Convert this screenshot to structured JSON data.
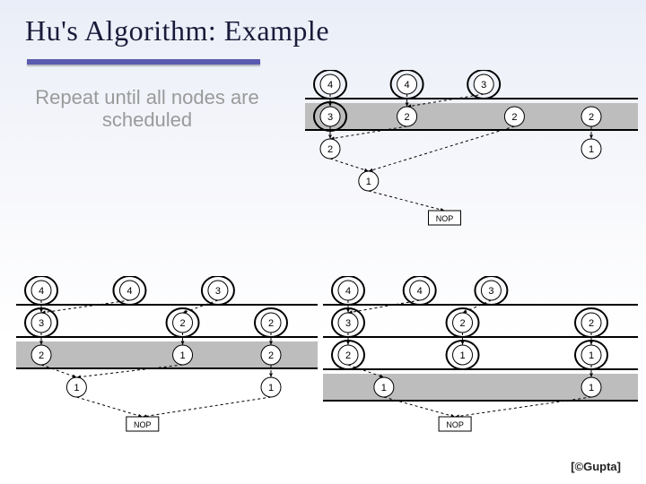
{
  "title": "Hu's Algorithm: Example",
  "subtext": "Repeat until all nodes are scheduled",
  "credit": "[©Gupta]",
  "sink_label": "NOP",
  "chart_data": [
    {
      "type": "dag-panel",
      "name": "top-right",
      "highlight_row": 1,
      "rows": [
        {
          "y": 0,
          "circled": [
            0,
            1,
            2
          ],
          "nodes": [
            {
              "x": 0,
              "label": "4"
            },
            {
              "x": 1,
              "label": "4"
            },
            {
              "x": 2,
              "label": "3"
            }
          ]
        },
        {
          "y": 1,
          "circled": [
            0
          ],
          "nodes": [
            {
              "x": 0,
              "label": "3"
            },
            {
              "x": 1,
              "label": "2"
            },
            {
              "x": 2.4,
              "label": "2"
            },
            {
              "x": 3.4,
              "label": "2"
            }
          ]
        },
        {
          "y": 2,
          "nodes": [
            {
              "x": 0,
              "label": "2"
            },
            {
              "x": 3.4,
              "label": "1"
            }
          ]
        },
        {
          "y": 3,
          "nodes": [
            {
              "x": 0.5,
              "label": "1"
            }
          ]
        }
      ],
      "edges": [
        [
          0,
          0,
          1,
          0
        ],
        [
          0,
          1,
          1,
          1
        ],
        [
          0,
          2,
          1,
          1
        ],
        [
          1,
          0,
          2,
          0
        ],
        [
          1,
          1,
          2,
          0
        ],
        [
          1,
          2,
          3,
          0
        ],
        [
          1,
          3,
          2,
          1
        ],
        [
          2,
          0,
          3,
          0
        ]
      ],
      "sink": true
    },
    {
      "type": "dag-panel",
      "name": "bottom-left",
      "highlight_row": 2,
      "rows": [
        {
          "y": 0,
          "circled": [
            0,
            1,
            2
          ],
          "nodes": [
            {
              "x": 0,
              "label": "4"
            },
            {
              "x": 1,
              "label": "4"
            },
            {
              "x": 2,
              "label": "3"
            }
          ]
        },
        {
          "y": 1,
          "circled": [
            0,
            1,
            2
          ],
          "nodes": [
            {
              "x": 0,
              "label": "3"
            },
            {
              "x": 1.6,
              "label": "2"
            },
            {
              "x": 2.6,
              "label": "2"
            }
          ]
        },
        {
          "y": 2,
          "nodes": [
            {
              "x": 0,
              "label": "2"
            },
            {
              "x": 1.6,
              "label": "1"
            },
            {
              "x": 2.6,
              "label": "2"
            }
          ]
        },
        {
          "y": 3,
          "nodes": [
            {
              "x": 0.4,
              "label": "1"
            },
            {
              "x": 2.6,
              "label": "1"
            }
          ]
        }
      ],
      "edges": [
        [
          0,
          0,
          1,
          0
        ],
        [
          0,
          1,
          1,
          0
        ],
        [
          0,
          2,
          1,
          1
        ],
        [
          1,
          0,
          2,
          0
        ],
        [
          1,
          1,
          2,
          1
        ],
        [
          1,
          2,
          2,
          2
        ],
        [
          2,
          0,
          3,
          0
        ],
        [
          2,
          1,
          3,
          0
        ],
        [
          2,
          2,
          3,
          1
        ]
      ],
      "sink": true
    },
    {
      "type": "dag-panel",
      "name": "bottom-right",
      "highlight_row": 3,
      "rows": [
        {
          "y": 0,
          "circled": [
            0,
            1,
            2
          ],
          "nodes": [
            {
              "x": 0,
              "label": "4"
            },
            {
              "x": 1,
              "label": "4"
            },
            {
              "x": 2,
              "label": "3"
            }
          ]
        },
        {
          "y": 1,
          "circled": [
            0,
            1,
            2
          ],
          "nodes": [
            {
              "x": 0,
              "label": "3"
            },
            {
              "x": 1.6,
              "label": "2"
            },
            {
              "x": 3.4,
              "label": "2"
            }
          ]
        },
        {
          "y": 2,
          "circled": [
            0,
            1,
            2
          ],
          "nodes": [
            {
              "x": 0,
              "label": "2"
            },
            {
              "x": 1.6,
              "label": "1"
            },
            {
              "x": 3.4,
              "label": "1"
            }
          ]
        },
        {
          "y": 3,
          "nodes": [
            {
              "x": 0.5,
              "label": "1"
            },
            {
              "x": 3.4,
              "label": "1"
            }
          ]
        }
      ],
      "edges": [
        [
          0,
          0,
          1,
          0
        ],
        [
          0,
          1,
          1,
          0
        ],
        [
          0,
          2,
          1,
          1
        ],
        [
          1,
          0,
          2,
          0
        ],
        [
          1,
          1,
          2,
          1
        ],
        [
          1,
          2,
          2,
          2
        ],
        [
          2,
          0,
          3,
          0
        ],
        [
          2,
          2,
          3,
          1
        ]
      ],
      "sink": true
    }
  ]
}
